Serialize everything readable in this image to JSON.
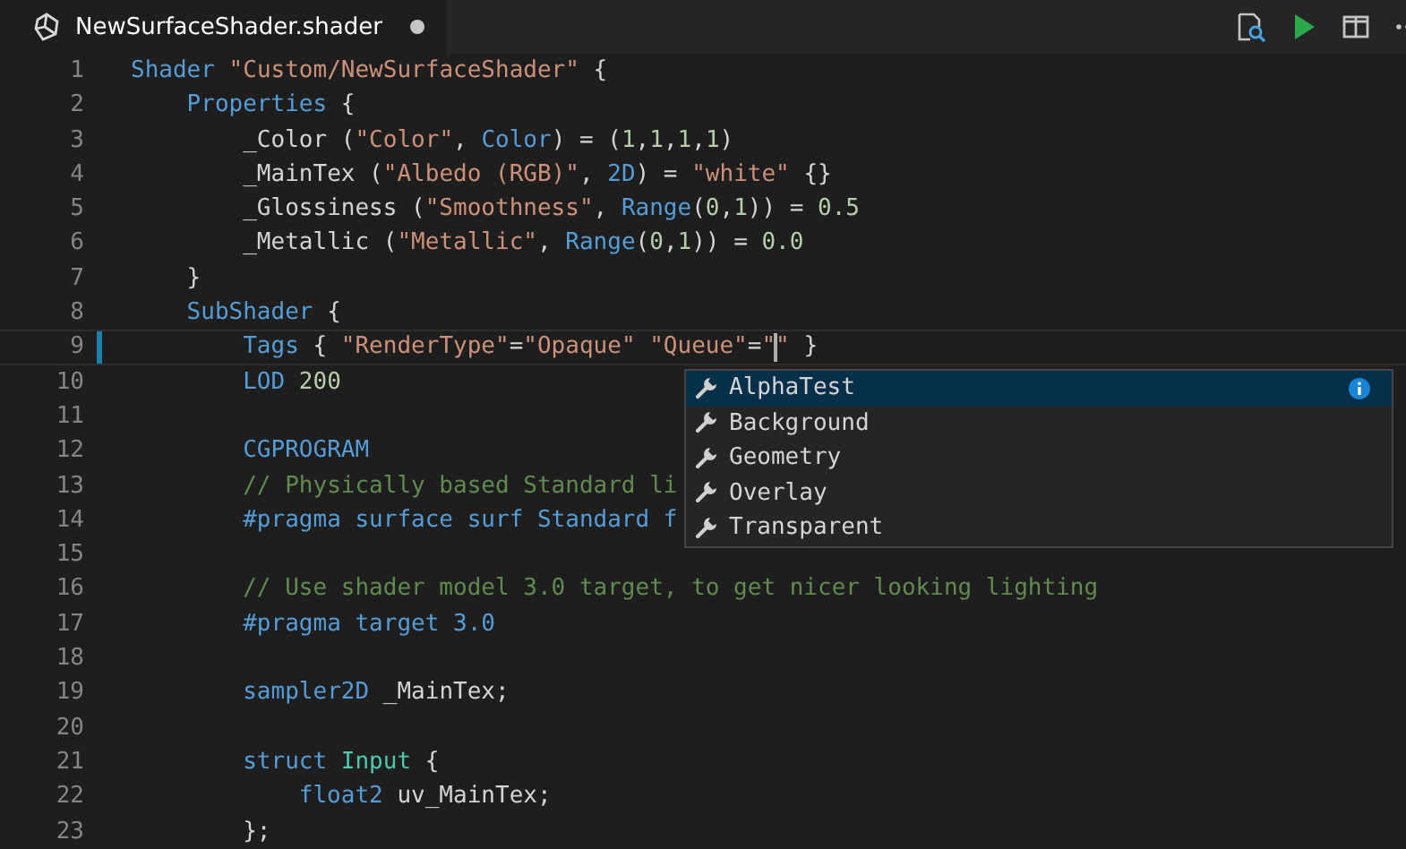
{
  "tab": {
    "title": "NewSurfaceShader.shader",
    "dirty": true
  },
  "editor": {
    "lines": [
      {
        "number": "1",
        "kind": "top",
        "current": false,
        "modified": false,
        "tokens": [
          {
            "kind": "kw",
            "text": "Shader"
          },
          {
            "kind": "str",
            "text": " \"Custom/NewSurfaceShader\""
          },
          {
            "kind": "plain",
            "text": " {"
          }
        ]
      },
      {
        "number": "2",
        "kind": "nested",
        "current": false,
        "modified": false,
        "tokens": [
          {
            "kind": "kw",
            "text": "Properties"
          },
          {
            "kind": "plain",
            "text": " {"
          }
        ]
      },
      {
        "number": "3",
        "kind": "deep",
        "current": false,
        "modified": false,
        "tokens": [
          {
            "kind": "plain",
            "text": "_Color ("
          },
          {
            "kind": "str",
            "text": "\"Color\""
          },
          {
            "kind": "plain",
            "text": ", "
          },
          {
            "kind": "kw",
            "text": "Color"
          },
          {
            "kind": "plain",
            "text": ") = ("
          },
          {
            "kind": "num",
            "text": "1"
          },
          {
            "kind": "plain",
            "text": ","
          },
          {
            "kind": "num",
            "text": "1"
          },
          {
            "kind": "plain",
            "text": ","
          },
          {
            "kind": "num",
            "text": "1"
          },
          {
            "kind": "plain",
            "text": ","
          },
          {
            "kind": "num",
            "text": "1"
          },
          {
            "kind": "plain",
            "text": ")"
          }
        ]
      },
      {
        "number": "4",
        "kind": "deep",
        "current": false,
        "modified": false,
        "tokens": [
          {
            "kind": "plain",
            "text": "_MainTex ("
          },
          {
            "kind": "str",
            "text": "\"Albedo (RGB)\""
          },
          {
            "kind": "plain",
            "text": ", "
          },
          {
            "kind": "kw",
            "text": "2D"
          },
          {
            "kind": "plain",
            "text": ") = "
          },
          {
            "kind": "str",
            "text": "\"white\""
          },
          {
            "kind": "plain",
            "text": " {}"
          }
        ]
      },
      {
        "number": "5",
        "kind": "deep",
        "current": false,
        "modified": false,
        "tokens": [
          {
            "kind": "plain",
            "text": "_Glossiness ("
          },
          {
            "kind": "str",
            "text": "\"Smoothness\""
          },
          {
            "kind": "plain",
            "text": ", "
          },
          {
            "kind": "kw",
            "text": "Range"
          },
          {
            "kind": "plain",
            "text": "("
          },
          {
            "kind": "num",
            "text": "0"
          },
          {
            "kind": "plain",
            "text": ","
          },
          {
            "kind": "num",
            "text": "1"
          },
          {
            "kind": "plain",
            "text": ")) = "
          },
          {
            "kind": "num",
            "text": "0.5"
          }
        ]
      },
      {
        "number": "6",
        "kind": "deep",
        "current": false,
        "modified": false,
        "tokens": [
          {
            "kind": "plain",
            "text": "_Metallic ("
          },
          {
            "kind": "str",
            "text": "\"Metallic\""
          },
          {
            "kind": "plain",
            "text": ", "
          },
          {
            "kind": "kw",
            "text": "Range"
          },
          {
            "kind": "plain",
            "text": "("
          },
          {
            "kind": "num",
            "text": "0"
          },
          {
            "kind": "plain",
            "text": ","
          },
          {
            "kind": "num",
            "text": "1"
          },
          {
            "kind": "plain",
            "text": ")) = "
          },
          {
            "kind": "num",
            "text": "0.0"
          }
        ]
      },
      {
        "number": "7",
        "kind": "nested",
        "current": false,
        "modified": false,
        "tokens": [
          {
            "kind": "plain",
            "text": "}"
          }
        ]
      },
      {
        "number": "8",
        "kind": "nested",
        "current": false,
        "modified": false,
        "tokens": [
          {
            "kind": "kw",
            "text": "SubShader"
          },
          {
            "kind": "plain",
            "text": " {"
          }
        ]
      },
      {
        "number": "9",
        "kind": "deep",
        "current": true,
        "modified": true,
        "tokens": [
          {
            "kind": "kw",
            "text": "Tags"
          },
          {
            "kind": "plain",
            "text": " { "
          },
          {
            "kind": "str",
            "text": "\"RenderType\""
          },
          {
            "kind": "plain",
            "text": "="
          },
          {
            "kind": "str",
            "text": "\"Opaque\" \"Queue\""
          },
          {
            "kind": "plain",
            "text": "="
          },
          {
            "kind": "str",
            "text": "\""
          },
          {
            "kind": "cursor"
          },
          {
            "kind": "str",
            "text": "\""
          },
          {
            "kind": "plain",
            "text": " }"
          }
        ]
      },
      {
        "number": "10",
        "kind": "deep",
        "current": false,
        "modified": false,
        "tokens": [
          {
            "kind": "kw",
            "text": "LOD"
          },
          {
            "kind": "num",
            "text": " 200"
          }
        ]
      },
      {
        "number": "11",
        "kind": "blank",
        "current": false,
        "modified": false
      },
      {
        "number": "12",
        "kind": "deep",
        "current": false,
        "modified": false,
        "tokens": [
          {
            "kind": "kw",
            "text": "CGPROGRAM"
          }
        ]
      },
      {
        "number": "13",
        "kind": "deep",
        "current": false,
        "modified": false,
        "tokens": [
          {
            "kind": "cmt",
            "text": "// Physically based Standard li"
          }
        ]
      },
      {
        "number": "14",
        "kind": "deep",
        "current": false,
        "modified": false,
        "tokens": [
          {
            "kind": "kw",
            "text": "#pragma surface surf Standard f"
          }
        ]
      },
      {
        "number": "15",
        "kind": "blank",
        "current": false,
        "modified": false
      },
      {
        "number": "16",
        "kind": "deep",
        "current": false,
        "modified": false,
        "tokens": [
          {
            "kind": "cmt",
            "text": "// Use shader model 3.0 target, to get nicer looking lighting"
          }
        ]
      },
      {
        "number": "17",
        "kind": "deep",
        "current": false,
        "modified": false,
        "tokens": [
          {
            "kind": "kw",
            "text": "#pragma target 3.0"
          }
        ]
      },
      {
        "number": "18",
        "kind": "blank",
        "current": false,
        "modified": false
      },
      {
        "number": "19",
        "kind": "deep",
        "current": false,
        "modified": false,
        "tokens": [
          {
            "kind": "kw",
            "text": "sampler2D"
          },
          {
            "kind": "plain",
            "text": " _MainTex;"
          }
        ]
      },
      {
        "number": "20",
        "kind": "blank",
        "current": false,
        "modified": false
      },
      {
        "number": "21",
        "kind": "deep",
        "current": false,
        "modified": false,
        "tokens": [
          {
            "kind": "kw",
            "text": "struct"
          },
          {
            "kind": "type",
            "text": " Input"
          },
          {
            "kind": "plain",
            "text": " {"
          }
        ]
      },
      {
        "number": "22",
        "kind": "deeper",
        "current": false,
        "modified": false,
        "tokens": [
          {
            "kind": "kw",
            "text": "float2"
          },
          {
            "kind": "plain",
            "text": " uv_MainTex;"
          }
        ]
      },
      {
        "number": "23",
        "kind": "deep",
        "current": false,
        "modified": false,
        "tokens": [
          {
            "kind": "plain",
            "text": "};"
          }
        ]
      }
    ]
  },
  "suggest": {
    "items": [
      {
        "label": "AlphaTest",
        "selected": true
      },
      {
        "label": "Background",
        "selected": false
      },
      {
        "label": "Geometry",
        "selected": false
      },
      {
        "label": "Overlay",
        "selected": false
      },
      {
        "label": "Transparent",
        "selected": false
      }
    ]
  }
}
